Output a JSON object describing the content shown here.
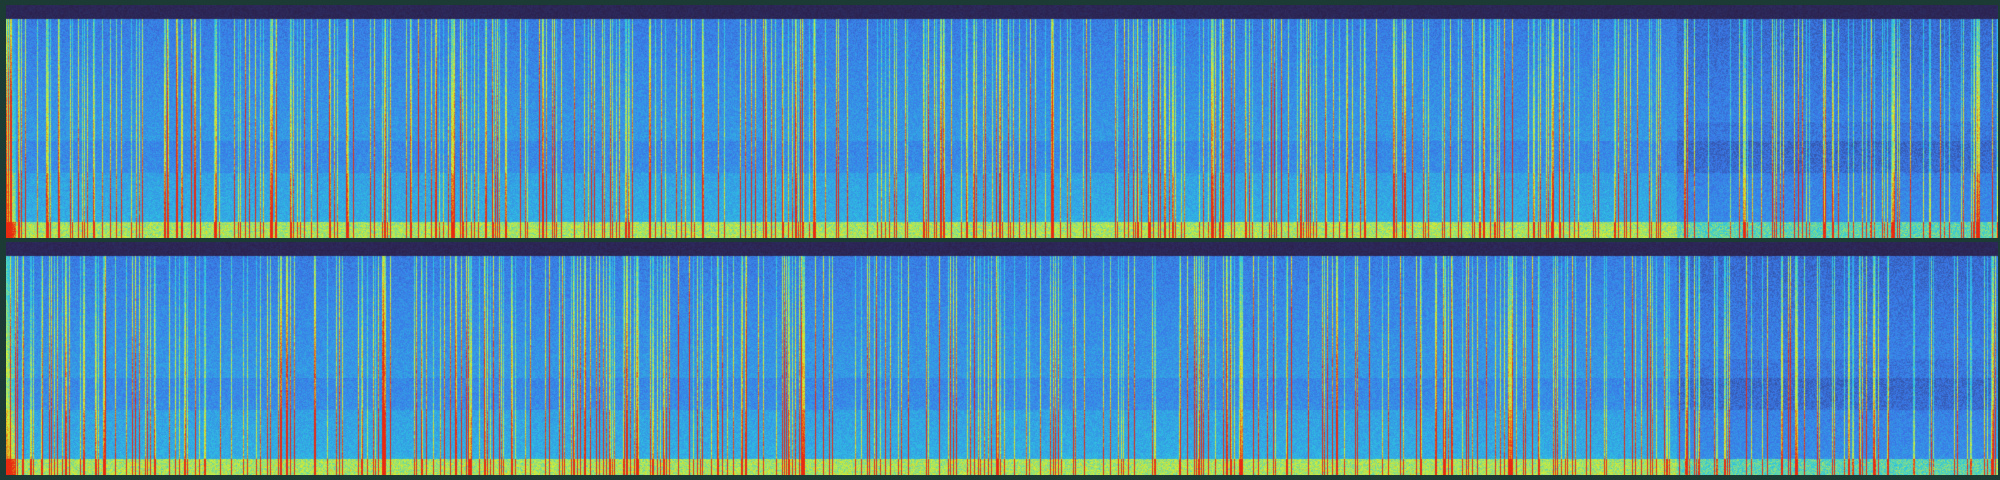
{
  "view": "spectrogram",
  "channels": [
    {
      "id": "left",
      "name": ""
    },
    {
      "id": "right",
      "name": ""
    }
  ],
  "colormap": {
    "low": "#2a1a40",
    "mid_low": "#3a78e8",
    "mid": "#2ec8e0",
    "mid_high": "#d8f030",
    "high": "#e82a10"
  },
  "background": "#1d3b35"
}
